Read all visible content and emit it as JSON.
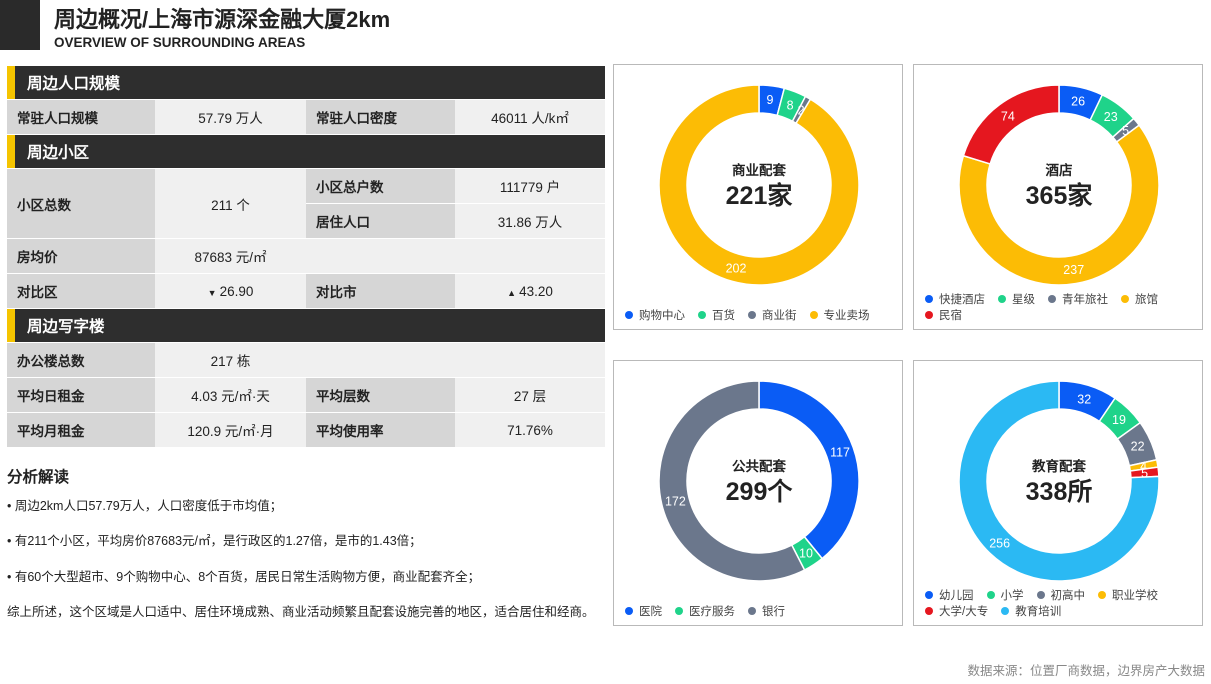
{
  "header": {
    "title": "周边概况/上海市源深金融大厦2km",
    "subtitle": "OVERVIEW OF SURROUNDING AREAS"
  },
  "population": {
    "section": "周边人口规模",
    "k1": "常驻人口规模",
    "v1": "57.79 万人",
    "k2": "常驻人口密度",
    "v2": "46011 人/k㎡"
  },
  "community": {
    "section": "周边小区",
    "total_k": "小区总数",
    "total_v": "211 个",
    "households_k": "小区总户数",
    "households_v": "111779 户",
    "residents_k": "居住人口",
    "residents_v": "31.86 万人",
    "price_k": "房均价",
    "price_v": "87683 元/㎡",
    "district_k": "对比区",
    "district_v": "26.90",
    "city_k": "对比市",
    "city_v": "43.20"
  },
  "office": {
    "section": "周边写字楼",
    "count_k": "办公楼总数",
    "count_v": "217 栋",
    "day_rent_k": "平均日租金",
    "day_rent_v": "4.03 元/㎡·天",
    "floors_k": "平均层数",
    "floors_v": "27 层",
    "month_rent_k": "平均月租金",
    "month_rent_v": "120.9 元/㎡·月",
    "usage_k": "平均使用率",
    "usage_v": "71.76%"
  },
  "analysis": {
    "title": "分析解读",
    "l1": "• 周边2km人口57.79万人，人口密度低于市均值；",
    "l2": "• 有211个小区，平均房价87683元/㎡，是行政区的1.27倍，是市的1.43倍；",
    "l3": "• 有60个大型超市、9个购物中心、8个百货，居民日常生活购物方便，商业配套齐全；",
    "l4": "综上所述，这个区域是人口适中、居住环境成熟、商业活动频繁且配套设施完善的地区，适合居住和经商。"
  },
  "colors": {
    "blue": "#0a5cf5",
    "green": "#1fd38a",
    "gray": "#6b778c",
    "yellow": "#fcbc05",
    "red": "#e5171f",
    "sky": "#2bb9f3",
    "up": "#e0232d",
    "down": "#12b06a"
  },
  "footer": "数据来源：位置厂商数据，边界房产大数据",
  "chart_data": [
    {
      "type": "pie",
      "title": "商业配套",
      "total": "221家",
      "categories": [
        "购物中心",
        "百货",
        "商业街",
        "专业卖场"
      ],
      "values": [
        9,
        8,
        2,
        202
      ],
      "colors": [
        "#0a5cf5",
        "#1fd38a",
        "#6b778c",
        "#fcbc05"
      ],
      "legend": "bottom"
    },
    {
      "type": "pie",
      "title": "酒店",
      "total": "365家",
      "categories": [
        "快捷酒店",
        "星级",
        "青年旅社",
        "旅馆",
        "民宿"
      ],
      "values": [
        26,
        23,
        5,
        237,
        74
      ],
      "colors": [
        "#0a5cf5",
        "#1fd38a",
        "#6b778c",
        "#fcbc05",
        "#e5171f"
      ],
      "legend": "bottom"
    },
    {
      "type": "pie",
      "title": "公共配套",
      "total": "299个",
      "categories": [
        "医院",
        "医疗服务",
        "银行"
      ],
      "values": [
        117,
        10,
        172
      ],
      "colors": [
        "#0a5cf5",
        "#1fd38a",
        "#6b778c"
      ],
      "legend": "bottom"
    },
    {
      "type": "pie",
      "title": "教育配套",
      "total": "338所",
      "categories": [
        "幼儿园",
        "小学",
        "初高中",
        "职业学校",
        "大学/大专",
        "教育培训"
      ],
      "values": [
        32,
        19,
        22,
        4,
        5,
        256
      ],
      "colors": [
        "#0a5cf5",
        "#1fd38a",
        "#6b778c",
        "#fcbc05",
        "#e5171f",
        "#2bb9f3"
      ],
      "legend": "bottom"
    }
  ]
}
